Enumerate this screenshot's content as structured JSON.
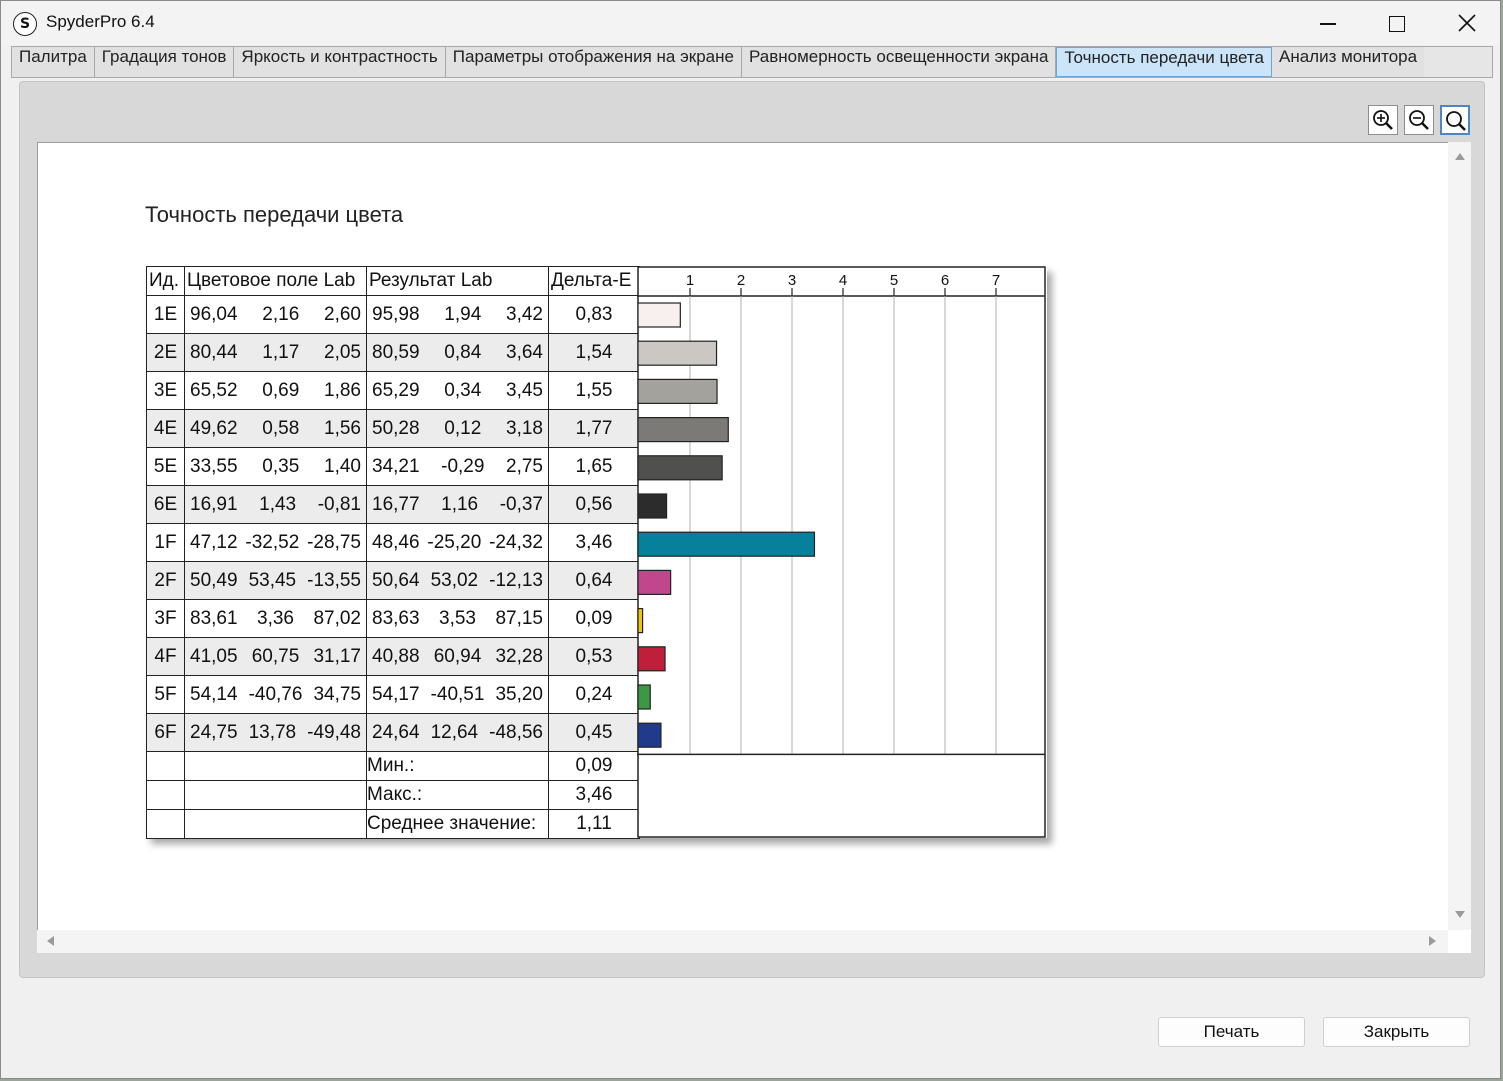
{
  "window": {
    "title": "SpyderPro 6.4",
    "icon_letter": "S"
  },
  "tabs": [
    {
      "label": "Палитра",
      "active": false
    },
    {
      "label": "Градация тонов",
      "active": false
    },
    {
      "label": "Яркость и контрастность",
      "active": false
    },
    {
      "label": "Параметры отображения на экране",
      "active": false
    },
    {
      "label": "Равномерность освещенности экрана",
      "active": false
    },
    {
      "label": "Точность передачи цвета",
      "active": true
    },
    {
      "label": "Анализ монитора",
      "active": false
    }
  ],
  "toolbar": {
    "icons": [
      "zoom-in-icon",
      "zoom-out-icon",
      "zoom-fit-icon"
    ]
  },
  "report": {
    "title": "Точность передачи цвета",
    "headers": {
      "id": "Ид.",
      "lab_target": "Цветовое поле Lab",
      "lab_result": "Результат Lab",
      "delta_e": "Дельта-E"
    },
    "rows": [
      {
        "id": "1E",
        "target": [
          "96,04",
          "2,16",
          "2,60"
        ],
        "result": [
          "95,98",
          "1,94",
          "3,42"
        ],
        "de": "0,83"
      },
      {
        "id": "2E",
        "target": [
          "80,44",
          "1,17",
          "2,05"
        ],
        "result": [
          "80,59",
          "0,84",
          "3,64"
        ],
        "de": "1,54"
      },
      {
        "id": "3E",
        "target": [
          "65,52",
          "0,69",
          "1,86"
        ],
        "result": [
          "65,29",
          "0,34",
          "3,45"
        ],
        "de": "1,55"
      },
      {
        "id": "4E",
        "target": [
          "49,62",
          "0,58",
          "1,56"
        ],
        "result": [
          "50,28",
          "0,12",
          "3,18"
        ],
        "de": "1,77"
      },
      {
        "id": "5E",
        "target": [
          "33,55",
          "0,35",
          "1,40"
        ],
        "result": [
          "34,21",
          "-0,29",
          "2,75"
        ],
        "de": "1,65"
      },
      {
        "id": "6E",
        "target": [
          "16,91",
          "1,43",
          "-0,81"
        ],
        "result": [
          "16,77",
          "1,16",
          "-0,37"
        ],
        "de": "0,56"
      },
      {
        "id": "1F",
        "target": [
          "47,12",
          "-32,52",
          "-28,75"
        ],
        "result": [
          "48,46",
          "-25,20",
          "-24,32"
        ],
        "de": "3,46"
      },
      {
        "id": "2F",
        "target": [
          "50,49",
          "53,45",
          "-13,55"
        ],
        "result": [
          "50,64",
          "53,02",
          "-12,13"
        ],
        "de": "0,64"
      },
      {
        "id": "3F",
        "target": [
          "83,61",
          "3,36",
          "87,02"
        ],
        "result": [
          "83,63",
          "3,53",
          "87,15"
        ],
        "de": "0,09"
      },
      {
        "id": "4F",
        "target": [
          "41,05",
          "60,75",
          "31,17"
        ],
        "result": [
          "40,88",
          "60,94",
          "32,28"
        ],
        "de": "0,53"
      },
      {
        "id": "5F",
        "target": [
          "54,14",
          "-40,76",
          "34,75"
        ],
        "result": [
          "54,17",
          "-40,51",
          "35,20"
        ],
        "de": "0,24"
      },
      {
        "id": "6F",
        "target": [
          "24,75",
          "13,78",
          "-49,48"
        ],
        "result": [
          "24,64",
          "12,64",
          "-48,56"
        ],
        "de": "0,45"
      }
    ],
    "stats": [
      {
        "label": "Мин.:",
        "value": "0,09"
      },
      {
        "label": "Макс.:",
        "value": "3,46"
      },
      {
        "label": "Среднее значение:",
        "value": "1,11"
      }
    ]
  },
  "chart_data": {
    "type": "bar",
    "orientation": "horizontal",
    "categories": [
      "1E",
      "2E",
      "3E",
      "4E",
      "5E",
      "6E",
      "1F",
      "2F",
      "3F",
      "4F",
      "5F",
      "6F"
    ],
    "values": [
      0.83,
      1.54,
      1.55,
      1.77,
      1.65,
      0.56,
      3.46,
      0.64,
      0.09,
      0.53,
      0.24,
      0.45
    ],
    "colors": [
      "#f7f0ee",
      "#cbc8c3",
      "#a4a29d",
      "#7b7a76",
      "#50504e",
      "#2c2c2c",
      "#06809b",
      "#c0478c",
      "#f2c600",
      "#bf1f3a",
      "#3c9845",
      "#213a8c"
    ],
    "xticks": [
      "1",
      "2",
      "3",
      "4",
      "5",
      "6",
      "7"
    ],
    "xlim": [
      0,
      8
    ],
    "grid": true
  },
  "footer": {
    "print_label": "Печать",
    "close_label": "Закрыть"
  }
}
